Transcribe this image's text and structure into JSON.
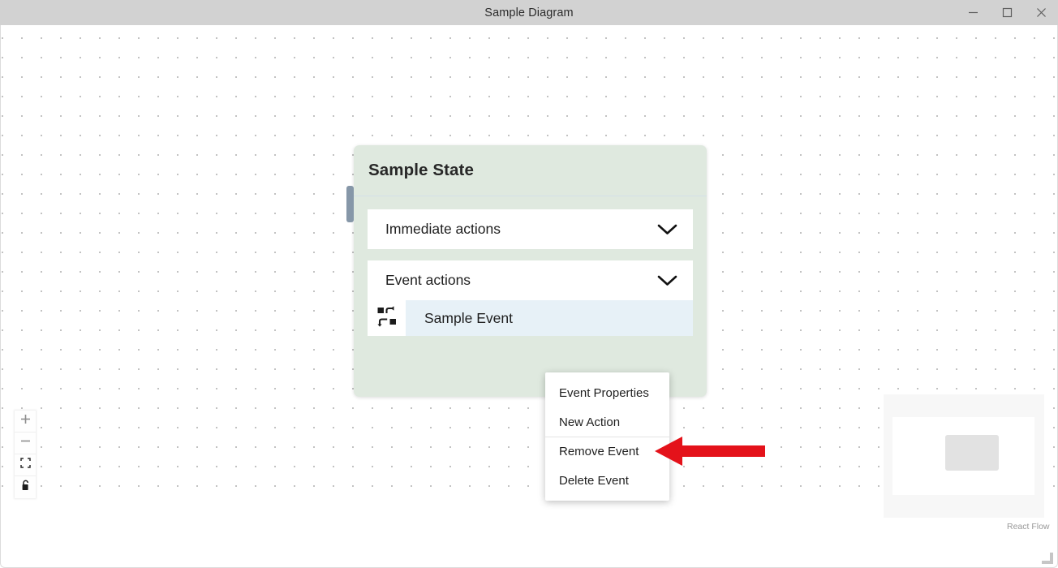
{
  "window": {
    "title": "Sample Diagram",
    "controls": [
      {
        "name": "minimize",
        "label": "–"
      },
      {
        "name": "maximize",
        "label": "□"
      },
      {
        "name": "close",
        "label": "×"
      }
    ]
  },
  "node": {
    "title": "Sample State",
    "accordions": [
      {
        "label": "Immediate actions",
        "icon": "chevron-down-icon"
      },
      {
        "label": "Event actions",
        "icon": "chevron-down-icon"
      }
    ],
    "event": {
      "name": "Sample Event",
      "icon": "swap-event-icon"
    },
    "colors": {
      "card_background": "#dfe9df",
      "handle": "#8697a8",
      "event_row_highlight": "#e7f1f7"
    }
  },
  "context_menu": {
    "items": [
      {
        "label": "Event Properties",
        "divider_above": false
      },
      {
        "label": "New Action",
        "divider_above": false
      },
      {
        "label": "Remove Event",
        "divider_above": true
      },
      {
        "label": "Delete Event",
        "divider_above": false
      }
    ]
  },
  "annotation": {
    "arrow": {
      "name": "red-pointer-arrow",
      "direction": "left",
      "color": "#e4121a",
      "points_to": "Remove Event"
    }
  },
  "controls": {
    "buttons": [
      {
        "name": "zoom-in",
        "icon": "plus-icon"
      },
      {
        "name": "zoom-out",
        "icon": "minus-icon"
      },
      {
        "name": "fit-view",
        "icon": "fit-view-icon"
      },
      {
        "name": "toggle-interactivity",
        "icon": "lock-icon"
      }
    ]
  },
  "minimap": {
    "attribution": "React Flow"
  }
}
